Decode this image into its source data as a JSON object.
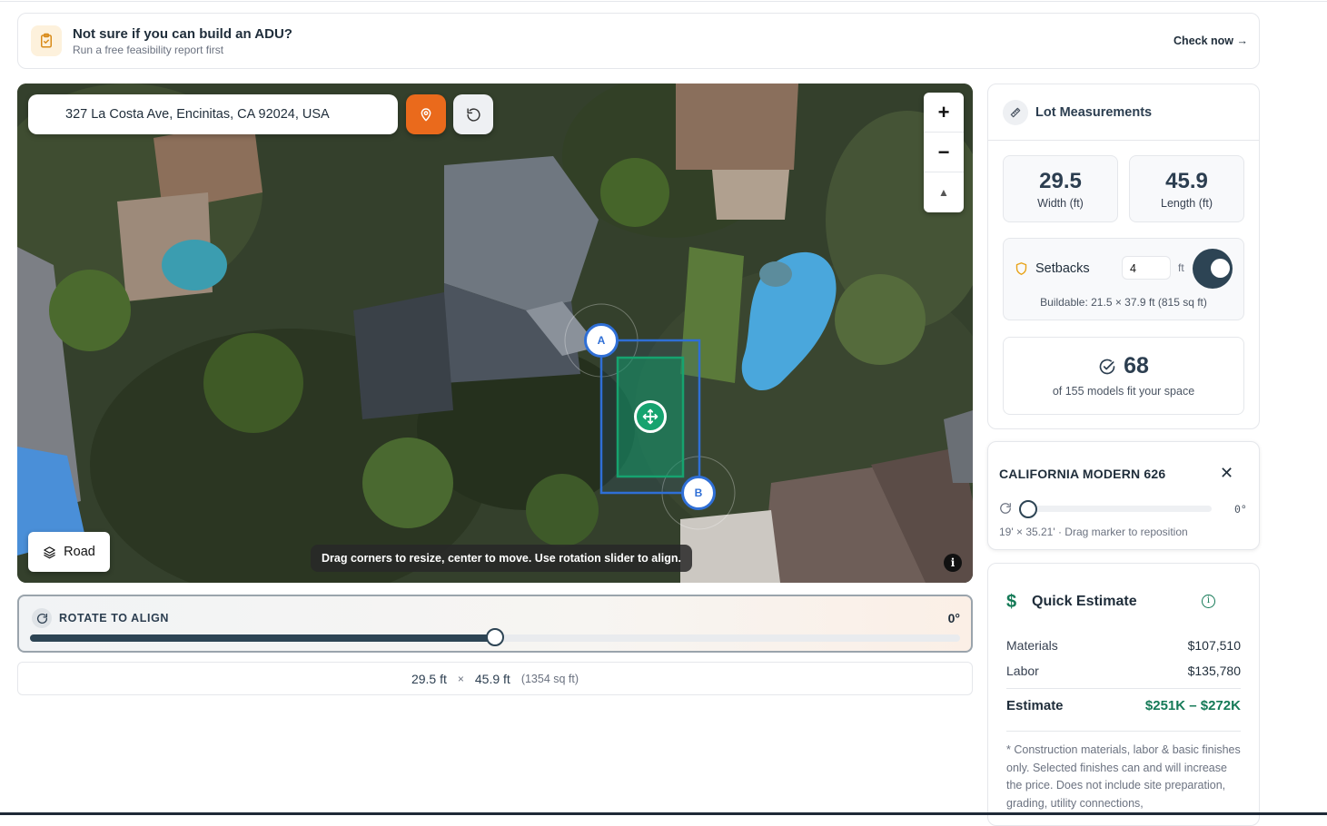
{
  "banner": {
    "title": "Not sure if you can build an ADU?",
    "subtitle": "Run a free feasibility report first",
    "link": "Check now →"
  },
  "map": {
    "address": "327 La Costa Ave, Encinitas, CA 92024, USA",
    "zoom_in": "+",
    "zoom_out": "−",
    "compass": "▲",
    "layer_button": "Road",
    "hint": "Drag corners to resize, center to move. Use rotation slider to align.",
    "info": "i",
    "corner_a": "A",
    "corner_b": "B"
  },
  "rotate": {
    "label": "ROTATE TO ALIGN",
    "value": "0°",
    "slider_fraction": 0.5
  },
  "dimensions": {
    "width": "29.5 ft",
    "separator": "×",
    "length": "45.9 ft",
    "area": "(1354 sq ft)"
  },
  "lot": {
    "title": "Lot Measurements",
    "width_value": "29.5",
    "width_label": "Width (ft)",
    "length_value": "45.9",
    "length_label": "Length (ft)",
    "setbacks_label": "Setbacks",
    "setbacks_value": "4",
    "setbacks_unit": "ft",
    "setbacks_enabled": true,
    "buildable": "Buildable: 21.5 × 37.9 ft (815 sq ft)",
    "models_count": "68",
    "models_sub": "of 155 models fit your space"
  },
  "model_card": {
    "title": "CALIFORNIA MODERN 626",
    "close": "✕",
    "rotation_value": "0°",
    "rotation_fraction": 0,
    "note": "19' × 35.21' · Drag marker to reposition"
  },
  "estimate": {
    "title": "Quick Estimate",
    "info": "i",
    "rows": [
      {
        "label": "Materials",
        "amount": "$107,510"
      },
      {
        "label": "Labor",
        "amount": "$135,780"
      }
    ],
    "total_label": "Estimate",
    "total_amount": "$251K – $272K",
    "note": "* Construction materials, labor & basic finishes only. Selected finishes can and will increase the price. Does not include site preparation, grading, utility connections,"
  },
  "colors": {
    "accent_dark": "#2d4454",
    "accent_orange": "#ea6a1c",
    "accent_green": "#157a57"
  }
}
